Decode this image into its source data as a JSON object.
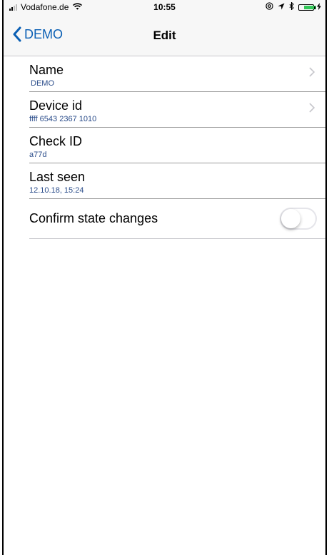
{
  "status_bar": {
    "carrier": "Vodafone.de",
    "time": "10:55",
    "wifi_icon": "wifi-icon",
    "right_icons": [
      "at-icon",
      "location-icon",
      "bluetooth-icon",
      "battery-icon",
      "charging-icon"
    ],
    "battery_color": "#34c759",
    "battery_level": 0.95
  },
  "nav": {
    "back_label": "DEMO",
    "title": "Edit",
    "accent_color": "#0a5fb4"
  },
  "rows": [
    {
      "title": "Name",
      "value": "DEMO",
      "disclosure": true
    },
    {
      "title": "Device id",
      "value": "ffff 6543 2367 1010",
      "disclosure": true
    },
    {
      "title": "Check ID",
      "value": "a77d",
      "disclosure": false
    },
    {
      "title": "Last seen",
      "value": "12.10.18, 15:24",
      "disclosure": false
    }
  ],
  "toggle": {
    "label": "Confirm state changes",
    "on": false
  },
  "colors": {
    "subtitle": "#2a4c8a",
    "separator": "#9b9b9b"
  }
}
